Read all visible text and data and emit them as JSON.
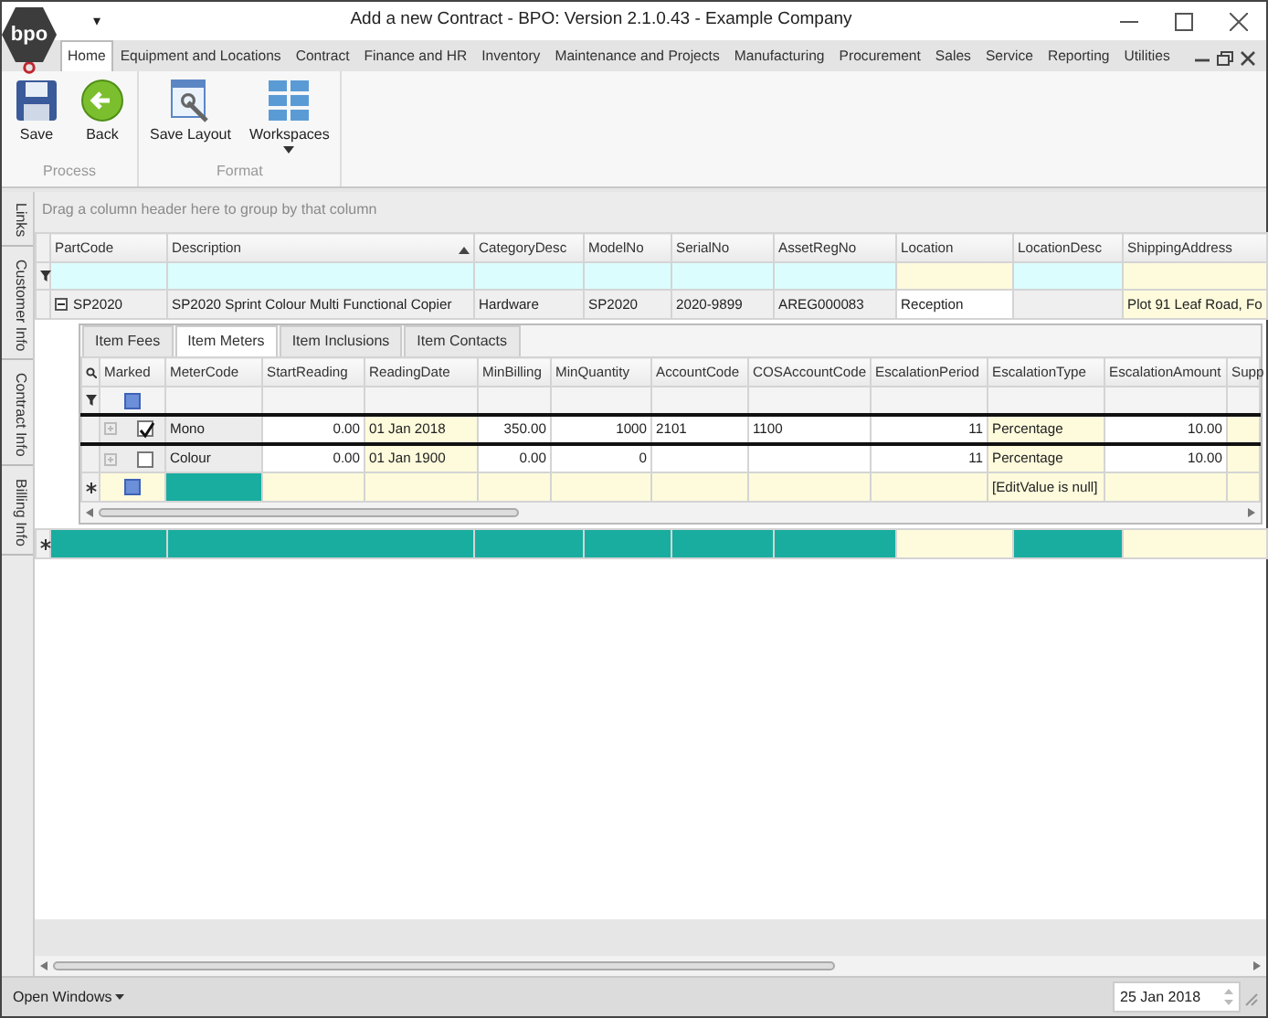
{
  "window": {
    "title": "Add a new Contract - BPO: Version 2.1.0.43 - Example Company",
    "logo_text": "bpo",
    "quick_access": "▾"
  },
  "menu_tabs": [
    {
      "label": "Home",
      "selected": true
    },
    {
      "label": "Equipment and Locations",
      "selected": false
    },
    {
      "label": "Contract",
      "selected": false
    },
    {
      "label": "Finance and HR",
      "selected": false
    },
    {
      "label": "Inventory",
      "selected": false
    },
    {
      "label": "Maintenance and Projects",
      "selected": false
    },
    {
      "label": "Manufacturing",
      "selected": false
    },
    {
      "label": "Procurement",
      "selected": false
    },
    {
      "label": "Sales",
      "selected": false
    },
    {
      "label": "Service",
      "selected": false
    },
    {
      "label": "Reporting",
      "selected": false
    },
    {
      "label": "Utilities",
      "selected": false
    }
  ],
  "ribbon_groups": [
    {
      "label": "Process",
      "buttons": [
        {
          "label": "Save",
          "kind": "save",
          "dropdown": false
        },
        {
          "label": "Back",
          "kind": "back",
          "dropdown": false
        }
      ]
    },
    {
      "label": "Format",
      "buttons": [
        {
          "label": "Save Layout",
          "kind": "layout",
          "dropdown": false
        },
        {
          "label": "Workspaces",
          "kind": "workspaces",
          "dropdown": true
        }
      ]
    }
  ],
  "side_tabs": [
    "Links",
    "Customer Info",
    "Contract Info",
    "Billing Info"
  ],
  "grid": {
    "group_panel": "Drag a column header here to group by that column",
    "columns": [
      {
        "label": "PartCode",
        "editable": false,
        "sorted": false
      },
      {
        "label": "Description",
        "editable": false,
        "sorted": true
      },
      {
        "label": "CategoryDesc",
        "editable": false,
        "sorted": false
      },
      {
        "label": "ModelNo",
        "editable": false,
        "sorted": false
      },
      {
        "label": "SerialNo",
        "editable": false,
        "sorted": false
      },
      {
        "label": "AssetRegNo",
        "editable": false,
        "sorted": false
      },
      {
        "label": "Location",
        "editable": true,
        "sorted": false
      },
      {
        "label": "LocationDesc",
        "editable": false,
        "sorted": false
      },
      {
        "label": "ShippingAddress",
        "editable": true,
        "sorted": false
      }
    ],
    "rows": [
      {
        "expanded": true,
        "cells": [
          {
            "text": "SP2020",
            "editing": false
          },
          {
            "text": "SP2020 Sprint Colour Multi Functional Copier",
            "editing": false
          },
          {
            "text": "Hardware",
            "editing": false
          },
          {
            "text": "SP2020",
            "editing": false
          },
          {
            "text": "2020-9899",
            "editing": false
          },
          {
            "text": "AREG000083",
            "editing": false
          },
          {
            "text": "Reception",
            "editing": true
          },
          {
            "editing": false
          },
          {
            "text": "Plot 91 Leaf Road, Fo",
            "editing": false
          }
        ]
      }
    ]
  },
  "detail": {
    "tabs": [
      {
        "label": "Item Fees",
        "selected": false
      },
      {
        "label": "Item Meters",
        "selected": true
      },
      {
        "label": "Item Inclusions",
        "selected": false
      },
      {
        "label": "Item Contacts",
        "selected": false
      }
    ],
    "columns": [
      {
        "label": "Marked",
        "kind": "check",
        "editable": false
      },
      {
        "label": "MeterCode",
        "kind": "code",
        "editable": false
      },
      {
        "label": "StartReading",
        "kind": "number",
        "editable": false
      },
      {
        "label": "ReadingDate",
        "kind": "date",
        "editable": true
      },
      {
        "label": "MinBilling",
        "kind": "number",
        "editable": false
      },
      {
        "label": "MinQuantity",
        "kind": "number",
        "editable": false
      },
      {
        "label": "AccountCode",
        "kind": "text",
        "editable": false
      },
      {
        "label": "COSAccountCode",
        "kind": "text",
        "editable": false
      },
      {
        "label": "EscalationPeriod",
        "kind": "number",
        "editable": false
      },
      {
        "label": "EscalationType",
        "kind": "combo",
        "editable": true
      },
      {
        "label": "EscalationAmount",
        "kind": "number",
        "editable": false
      },
      {
        "label": "Supp",
        "kind": "text",
        "editable": true
      }
    ],
    "rows": [
      {
        "marked": true,
        "focused": true,
        "cells": [
          null,
          "Mono",
          "0.00",
          "01 Jan 2018",
          "350.00",
          "1000",
          "2101",
          "1100",
          "11",
          "Percentage",
          "10.00",
          null
        ]
      },
      {
        "marked": false,
        "focused": false,
        "cells": [
          null,
          "Colour",
          "0.00",
          "01 Jan 1900",
          "0.00",
          "0",
          null,
          null,
          "11",
          "Percentage",
          "10.00",
          null
        ]
      }
    ],
    "new_row_text": "[EditValue is null]"
  },
  "status_bar": {
    "open_windows": "Open Windows",
    "date": "25 Jan 2018"
  }
}
